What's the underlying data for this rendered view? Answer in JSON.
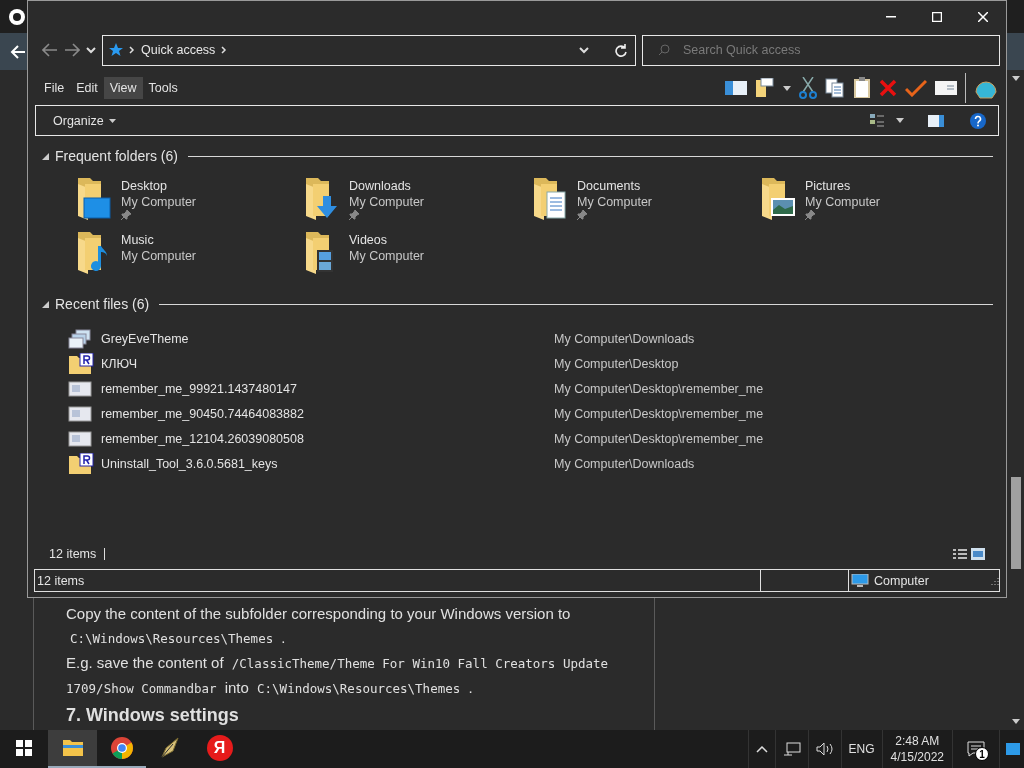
{
  "page": {
    "heading": "7. Windows settings",
    "paragraphs": [
      {
        "segments": [
          {
            "kind": "text",
            "text": "Copy the content of the subfolder corresponding to your Windows version to "
          },
          {
            "kind": "code",
            "text": "C:\\Windows\\Resources\\Themes"
          },
          {
            "kind": "text",
            "text": " ."
          }
        ]
      },
      {
        "segments": [
          {
            "kind": "text",
            "text": "E.g. save the content of "
          },
          {
            "kind": "code",
            "text": "/ClassicTheme/Theme For Win10 Fall Creators Update 1709/Show Commandbar"
          },
          {
            "kind": "text",
            "text": " into "
          },
          {
            "kind": "code",
            "text": "C:\\Windows\\Resources\\Themes"
          },
          {
            "kind": "text",
            "text": " ."
          }
        ]
      }
    ]
  },
  "window": {
    "path": "Quick access",
    "search": {
      "placeholder": "Search Quick access"
    }
  },
  "menu": [
    {
      "label": "File",
      "selected": false
    },
    {
      "label": "Edit",
      "selected": false
    },
    {
      "label": "View",
      "selected": true
    },
    {
      "label": "Tools",
      "selected": false
    }
  ],
  "command_bar": {
    "organize": "Organize"
  },
  "frequent": {
    "title": "Frequent folders (6)",
    "expanded": true,
    "items": [
      {
        "name": "Desktop",
        "location": "My Computer",
        "pinned": true,
        "kind": "desktop"
      },
      {
        "name": "Downloads",
        "location": "My Computer",
        "pinned": true,
        "kind": "downloads"
      },
      {
        "name": "Documents",
        "location": "My Computer",
        "pinned": true,
        "kind": "documents"
      },
      {
        "name": "Pictures",
        "location": "My Computer",
        "pinned": true,
        "kind": "pictures"
      },
      {
        "name": "Music",
        "location": "My Computer",
        "pinned": false,
        "kind": "music"
      },
      {
        "name": "Videos",
        "location": "My Computer",
        "pinned": false,
        "kind": "videos"
      }
    ]
  },
  "recent": {
    "title": "Recent files (6)",
    "expanded": true,
    "items": [
      {
        "name": "GreyEveTheme",
        "path": "My Computer\\Downloads",
        "kind": "theme"
      },
      {
        "name": "КЛЮЧ",
        "path": "My Computer\\Desktop",
        "kind": "key"
      },
      {
        "name": "remember_me_99921.1437480147",
        "path": "My Computer\\Desktop\\remember_me",
        "kind": "image"
      },
      {
        "name": "remember_me_90450.74464083882",
        "path": "My Computer\\Desktop\\remember_me",
        "kind": "image"
      },
      {
        "name": "remember_me_12104.26039080508",
        "path": "My Computer\\Desktop\\remember_me",
        "kind": "image"
      },
      {
        "name": "Uninstall_Tool_3.6.0.5681_keys",
        "path": "My Computer\\Downloads",
        "kind": "key"
      }
    ]
  },
  "details_bar": {
    "count": "12 items"
  },
  "status_bar": {
    "count": "12 items",
    "location": "Computer"
  },
  "taskbar": {
    "apps": [
      {
        "kind": "explorer",
        "active": true,
        "running": true
      },
      {
        "kind": "chrome",
        "active": false,
        "running": true
      },
      {
        "kind": "pen",
        "active": false,
        "running": false
      },
      {
        "kind": "yandex",
        "glyph": "Я",
        "active": false,
        "running": false
      }
    ],
    "language": "ENG",
    "time": "2:48 AM",
    "date": "4/15/2022",
    "notifications": "1"
  }
}
